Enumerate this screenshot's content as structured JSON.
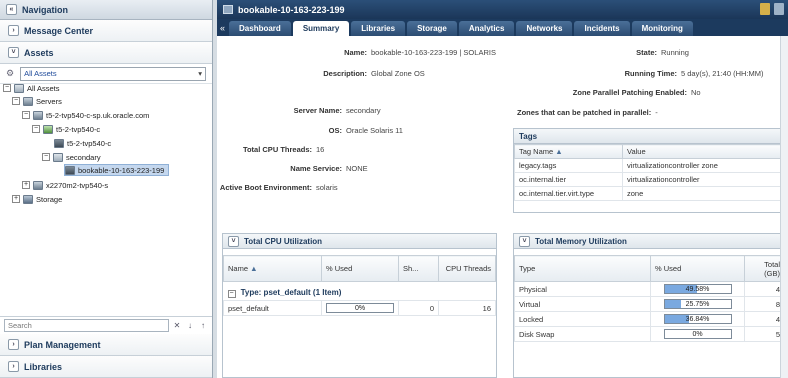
{
  "left": {
    "nav_title": "Navigation",
    "message_center": "Message Center",
    "assets": "Assets",
    "filter_selected": "All Assets",
    "tree": {
      "all_assets": "All Assets",
      "servers": "Servers",
      "host1": "t5-2-tvp540-c-sp.uk.oracle.com",
      "host1c": "t5-2-tvp540-c",
      "host1c_child": "t5-2-tvp540-c",
      "secondary": "secondary",
      "zone": "bookable-10-163-223-199",
      "x2270": "x2270m2-tvp540-s",
      "storage": "Storage"
    },
    "search_placeholder": "Search",
    "plan_management": "Plan Management",
    "libraries": "Libraries"
  },
  "main": {
    "title": "bookable-10-163-223-199",
    "tabs": [
      "Dashboard",
      "Summary",
      "Libraries",
      "Storage",
      "Analytics",
      "Networks",
      "Incidents",
      "Monitoring"
    ],
    "active_tab": "Summary",
    "summary": {
      "name_label": "Name:",
      "name_value": "bookable-10-163-223-199 | SOLARIS",
      "desc_label": "Description:",
      "desc_value": "Global Zone OS",
      "server_label": "Server Name:",
      "server_value": "secondary",
      "os_label": "OS:",
      "os_value": "Oracle Solaris 11",
      "cpu_label": "Total CPU Threads:",
      "cpu_value": "16",
      "ns_label": "Name Service:",
      "ns_value": "NONE",
      "abe_label": "Active Boot Environment:",
      "abe_value": "solaris",
      "state_label": "State:",
      "state_value": "Running",
      "runtime_label": "Running Time:",
      "runtime_value": "5 day(s), 21:40 (HH:MM)",
      "zpp_label": "Zone Parallel Patching Enabled:",
      "zpp_value": "No",
      "zones_label": "Zones that can be patched in parallel:",
      "zones_value": "-"
    },
    "tags": {
      "title": "Tags",
      "col_name": "Tag Name",
      "col_value": "Value",
      "rows": [
        {
          "name": "legacy.tags",
          "value": "virtualizationcontroller zone"
        },
        {
          "name": "oc.internal.tier",
          "value": "virtualizationcontroller"
        },
        {
          "name": "oc.internal.tier.virt.type",
          "value": "zone"
        }
      ]
    },
    "cpu_panel": {
      "title": "Total CPU Utilization",
      "cols": [
        "Name",
        "% Used",
        "Sh...",
        "CPU Threads"
      ],
      "group": "Type: pset_default (1 Item)",
      "row": {
        "name": "pset_default",
        "used": "0%",
        "used_value": 0,
        "sh": "0",
        "threads": "16"
      }
    },
    "mem_panel": {
      "title": "Total Memory Utilization",
      "cols": [
        "Type",
        "% Used",
        "Total (GB)"
      ],
      "rows": [
        {
          "type": "Physical",
          "used": "49.58%",
          "used_value": 49.58,
          "total": "4"
        },
        {
          "type": "Virtual",
          "used": "25.75%",
          "used_value": 25.75,
          "total": "8"
        },
        {
          "type": "Locked",
          "used": "36.84%",
          "used_value": 36.84,
          "total": "4"
        },
        {
          "type": "Disk Swap",
          "used": "0%",
          "used_value": 0,
          "total": "5"
        }
      ]
    }
  }
}
